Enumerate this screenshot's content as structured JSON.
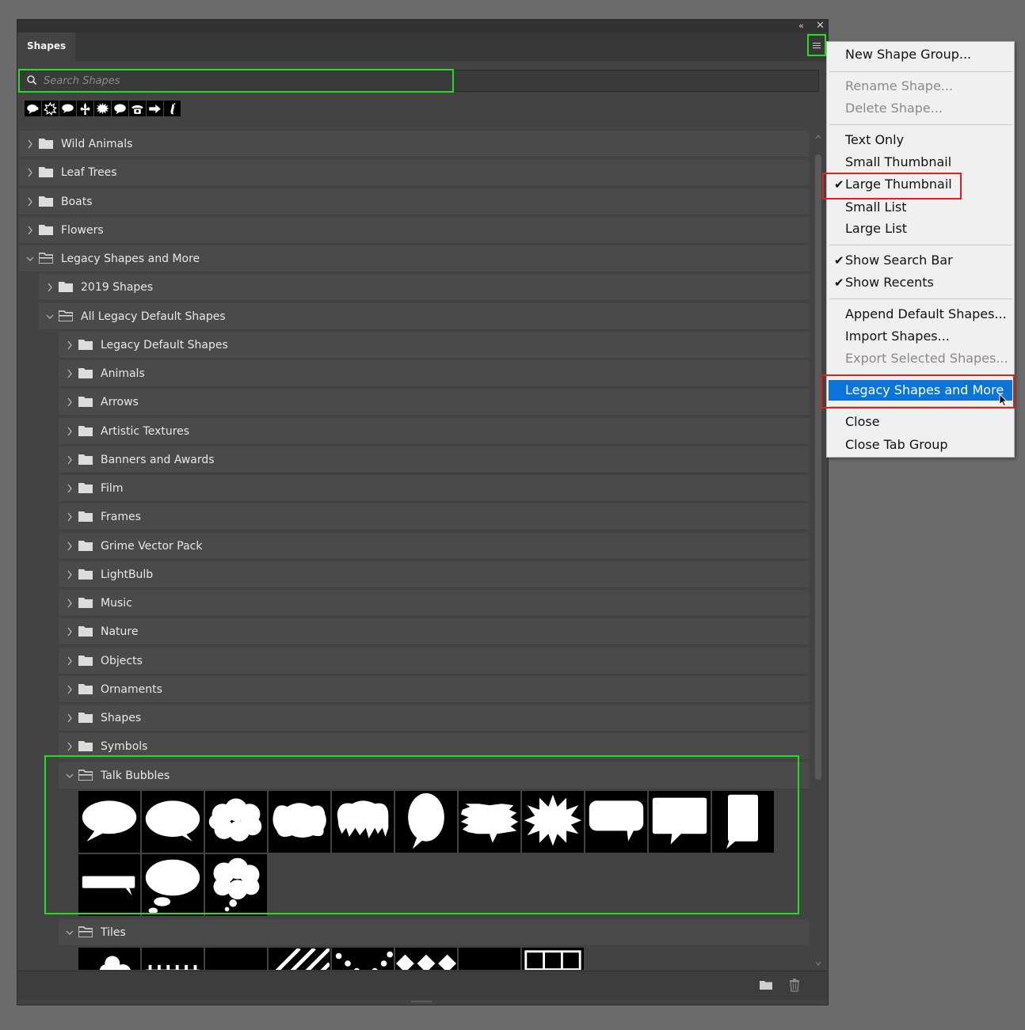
{
  "panel": {
    "tab_label": "Shapes",
    "collapse_icon": "double-chevron-left-icon",
    "close_icon": "close-icon",
    "menu_icon": "hamburger-menu-icon"
  },
  "search": {
    "placeholder": "Search Shapes",
    "value": ""
  },
  "recents": [
    "talk-bubble-icon",
    "burst-icon",
    "oval-bubble-icon",
    "fleur-de-lis-icon",
    "star-burst-icon",
    "speech-bubble-icon",
    "telephone-icon",
    "arrow-icon",
    "foot-icon"
  ],
  "tree": {
    "rows": [
      {
        "label": "Wild Animals",
        "level": 0,
        "expanded": false
      },
      {
        "label": "Leaf Trees",
        "level": 0,
        "expanded": false
      },
      {
        "label": "Boats",
        "level": 0,
        "expanded": false
      },
      {
        "label": "Flowers",
        "level": 0,
        "expanded": false
      },
      {
        "label": "Legacy Shapes and More",
        "level": 0,
        "expanded": true
      },
      {
        "label": "2019 Shapes",
        "level": 1,
        "expanded": false
      },
      {
        "label": "All Legacy Default Shapes",
        "level": 1,
        "expanded": true
      },
      {
        "label": "Legacy Default Shapes",
        "level": 2,
        "expanded": false
      },
      {
        "label": "Animals",
        "level": 2,
        "expanded": false
      },
      {
        "label": "Arrows",
        "level": 2,
        "expanded": false
      },
      {
        "label": "Artistic Textures",
        "level": 2,
        "expanded": false
      },
      {
        "label": "Banners and Awards",
        "level": 2,
        "expanded": false
      },
      {
        "label": "Film",
        "level": 2,
        "expanded": false
      },
      {
        "label": "Frames",
        "level": 2,
        "expanded": false
      },
      {
        "label": "Grime Vector Pack",
        "level": 2,
        "expanded": false
      },
      {
        "label": "LightBulb",
        "level": 2,
        "expanded": false
      },
      {
        "label": "Music",
        "level": 2,
        "expanded": false
      },
      {
        "label": "Nature",
        "level": 2,
        "expanded": false
      },
      {
        "label": "Objects",
        "level": 2,
        "expanded": false
      },
      {
        "label": "Ornaments",
        "level": 2,
        "expanded": false
      },
      {
        "label": "Shapes",
        "level": 2,
        "expanded": false
      },
      {
        "label": "Symbols",
        "level": 2,
        "expanded": false
      },
      {
        "label": "Talk Bubbles",
        "level": 2,
        "expanded": true
      },
      {
        "label": "Tiles",
        "level": 2,
        "expanded": true
      }
    ],
    "talk_bubbles_shapes": [
      "oval-talk-bubble",
      "round-talk-bubble",
      "cloud-bubble",
      "wavy-bubble",
      "dripping-bubble",
      "egg-bubble",
      "jagged-banner-bubble",
      "starburst-bubble",
      "rounded-rect-bubble",
      "rect-bubble",
      "tall-rect-bubble",
      "bar-bubble",
      "thought-bubble",
      "cloud-thought-bubble"
    ],
    "tiles_shapes": [
      "blob-tile",
      "fence-tile",
      "zigzag-tile",
      "stripes-tile",
      "dots-tile",
      "diamonds-tile",
      "windows-tile",
      "grid-tile"
    ]
  },
  "footer": {
    "new_group_icon": "new-folder-icon",
    "delete_icon": "trash-icon"
  },
  "menu": {
    "items": [
      {
        "label": "New Shape Group...",
        "state": "enabled"
      },
      {
        "label": "Rename Shape...",
        "state": "disabled"
      },
      {
        "label": "Delete Shape...",
        "state": "disabled"
      },
      {
        "label": "Text Only",
        "state": "enabled"
      },
      {
        "label": "Small Thumbnail",
        "state": "enabled"
      },
      {
        "label": "Large Thumbnail",
        "state": "checked"
      },
      {
        "label": "Small List",
        "state": "enabled"
      },
      {
        "label": "Large List",
        "state": "enabled"
      },
      {
        "label": "Show Search Bar",
        "state": "checked"
      },
      {
        "label": "Show Recents",
        "state": "checked"
      },
      {
        "label": "Append Default Shapes...",
        "state": "enabled"
      },
      {
        "label": "Import Shapes...",
        "state": "enabled"
      },
      {
        "label": "Export Selected Shapes...",
        "state": "disabled"
      },
      {
        "label": "Legacy Shapes and More",
        "state": "highlighted"
      },
      {
        "label": "Close",
        "state": "enabled"
      },
      {
        "label": "Close Tab Group",
        "state": "enabled"
      }
    ],
    "check_glyph": "✔"
  },
  "colors": {
    "highlight_green": "#22dd22",
    "highlight_red": "#e01f1f",
    "menu_active": "#0a74d9"
  }
}
